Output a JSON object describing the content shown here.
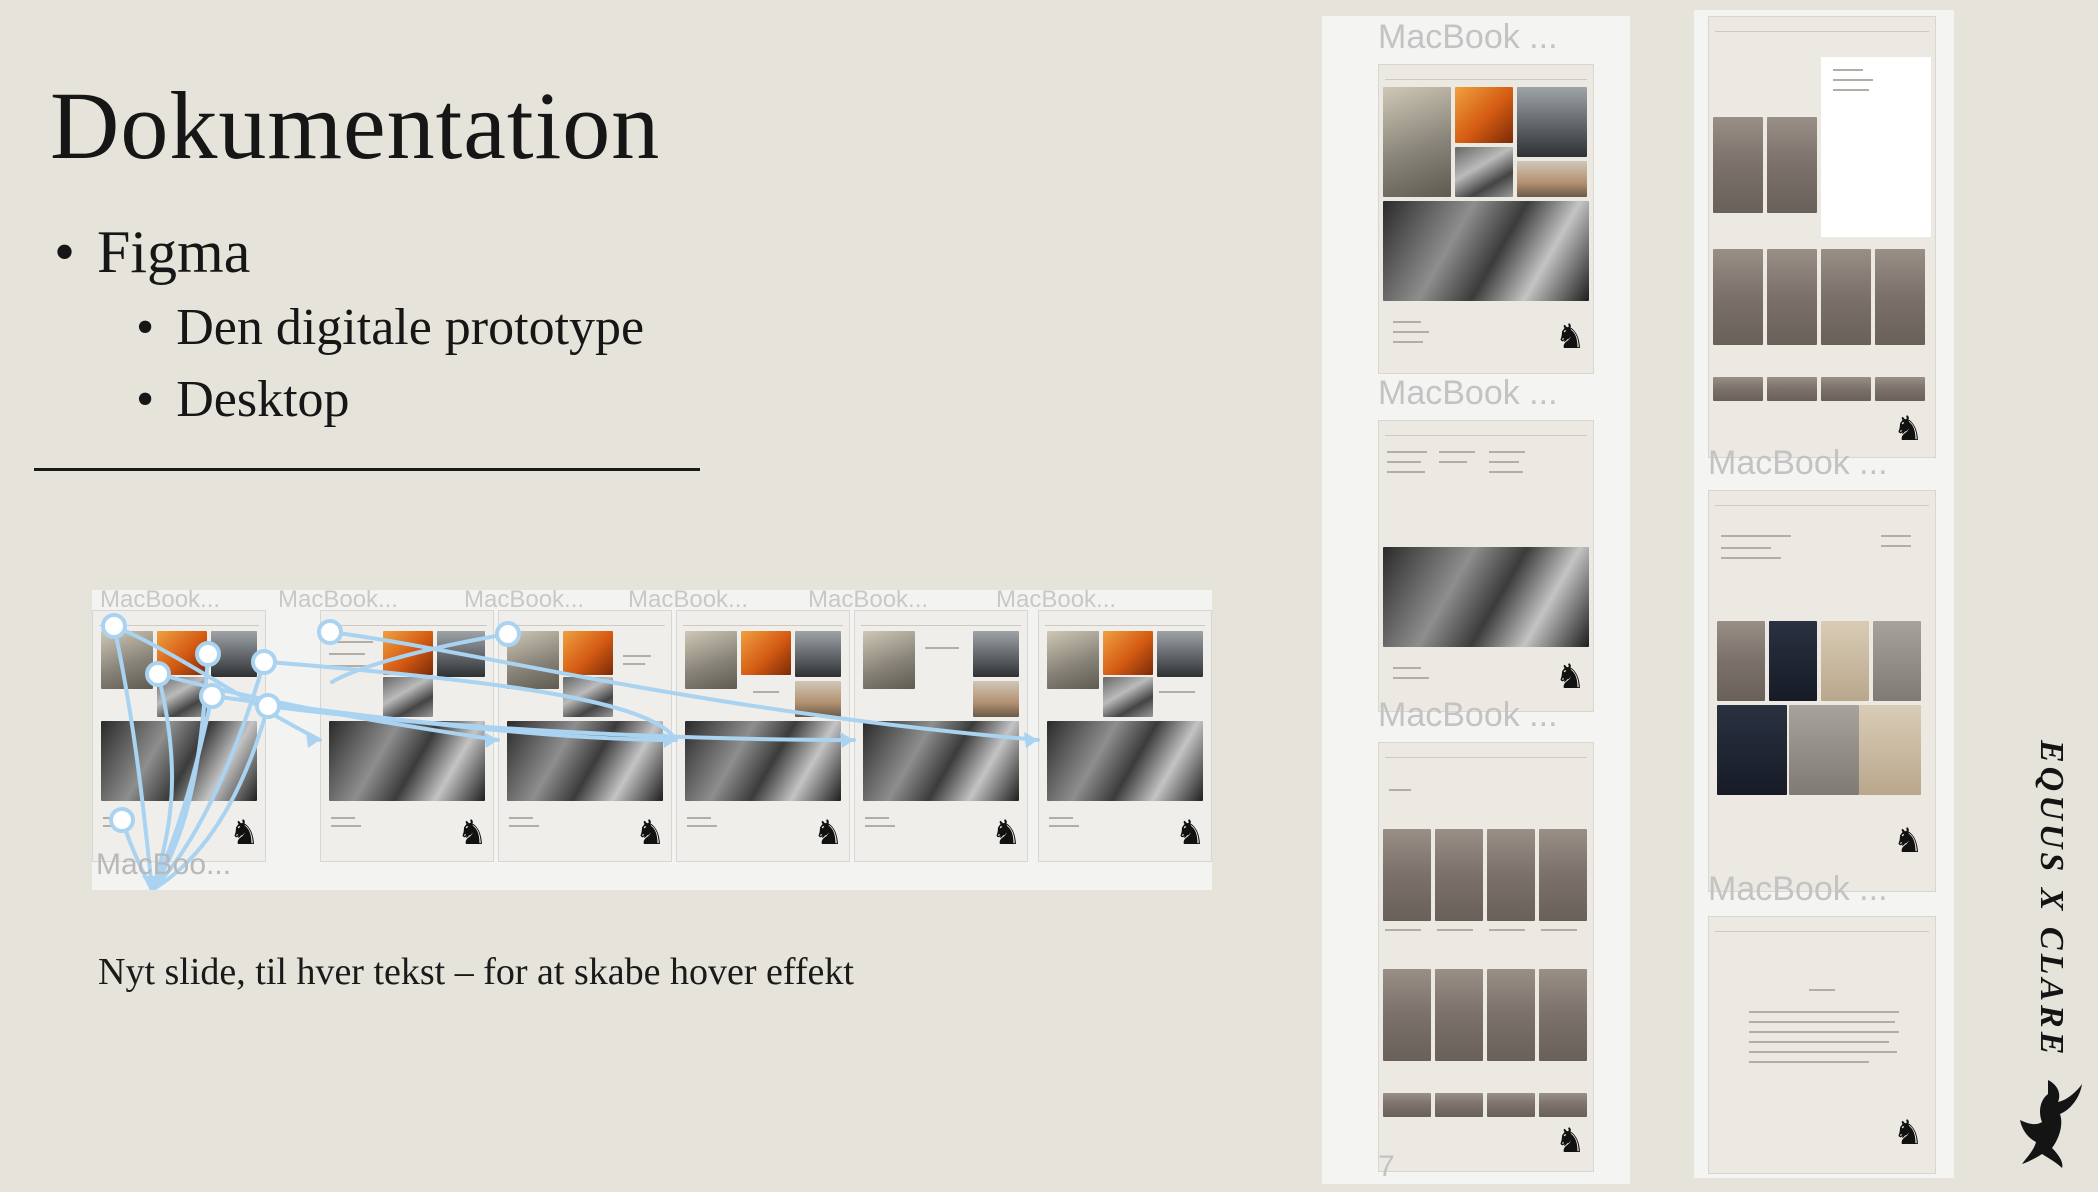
{
  "slide": {
    "title": "Dokumentation",
    "bullets": [
      {
        "level": 1,
        "text": "Figma"
      },
      {
        "level": 2,
        "text": "Den digitale prototype"
      },
      {
        "level": 2,
        "text": "Desktop"
      }
    ],
    "caption": "Nyt slide, til hver tekst – for at skabe hover effekt",
    "brand_vertical": "EQUUS X CLARE"
  },
  "prototype_strip": {
    "frame_labels": [
      "MacBook...",
      "MacBook...",
      "MacBook...",
      "MacBook...",
      "MacBook...",
      "MacBook..."
    ],
    "bottom_label": "MacBoo..."
  },
  "vertical_frames": {
    "column1": {
      "labels": [
        "MacBook ...",
        "MacBook ...",
        "MacBook ..."
      ],
      "page_number": "7"
    },
    "column2": {
      "labels": [
        "MacBook ...",
        "MacBook ..."
      ]
    }
  },
  "colors": {
    "background": "#e6e3da",
    "text": "#161616",
    "prototype_arrow": "#a9d3f0",
    "frame_label": "#c3c3c3"
  },
  "icons": [
    "horse-rider-logo"
  ]
}
